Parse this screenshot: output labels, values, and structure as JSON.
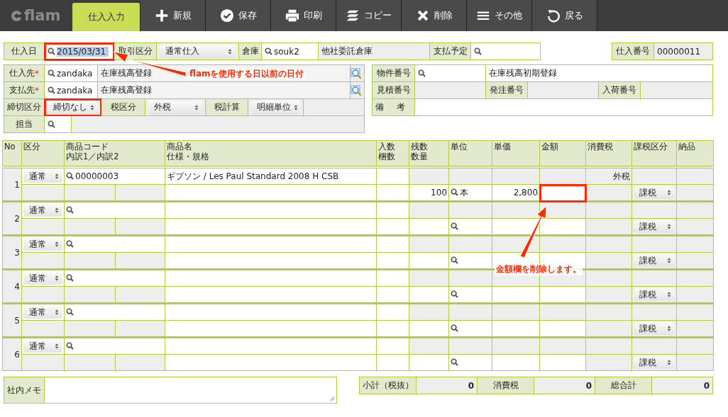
{
  "toolbar": {
    "logo": "flam",
    "items": [
      {
        "label": "仕入入力",
        "kind": "tab",
        "selected": true
      },
      {
        "label": "新規",
        "kind": "plus",
        "selected": false
      },
      {
        "label": "保存",
        "kind": "check",
        "selected": false
      },
      {
        "label": "印刷",
        "kind": "printer",
        "selected": false
      },
      {
        "label": "コピー",
        "kind": "copy",
        "selected": false
      },
      {
        "label": "削除",
        "kind": "cross",
        "selected": false
      },
      {
        "label": "その他",
        "kind": "menu",
        "selected": false
      },
      {
        "label": "戻る",
        "kind": "back",
        "selected": false
      }
    ]
  },
  "header": {
    "date_label": "仕入日",
    "date": "2015/03/31",
    "date_highlighted": true,
    "trade_label": "取引区分",
    "trade_type": "通常仕入",
    "warehouse_label": "倉庫",
    "warehouse_code": "souk2",
    "warehouse_name": "他社委託倉庫",
    "payment_label": "支払予定",
    "number_label": "仕入番号",
    "number": "00000011"
  },
  "supplier": {
    "supplier_label": "仕入先",
    "supplier_code": "zandaka",
    "supplier_name": "在庫残高登録",
    "supplier_mark": "*",
    "payee_label": "支払先",
    "payee_mark": "*",
    "payee_code": "zandaka",
    "payee_name": "在庫残高登録",
    "closing_label": "締切区分",
    "closing": "締切なし",
    "closing_highlighted": true,
    "tax_label": "税区分",
    "tax": "外税",
    "tax_calc_label": "税計算",
    "tax_calc": "明細単位",
    "staff_label": "担当"
  },
  "project": {
    "project_label": "物件番号",
    "project_name": "在庫残高初期登録",
    "estimate_label": "見積番号",
    "order_label": "発注番号",
    "arrival_label": "入荷番号",
    "note_label": "備考"
  },
  "columns": {
    "no": "No",
    "category": "区分",
    "code": "商品コード",
    "breakdown": "内訳1／内訳2",
    "name": "商品名",
    "spec": "仕様・規格",
    "pack": "入数",
    "packs": "梱数",
    "remaining": "残数",
    "quantity": "数量",
    "unit": "単位",
    "price": "単価",
    "amount": "金額",
    "tax": "消費税",
    "tax_type": "課税区分",
    "delivery": "納品"
  },
  "rows": [
    {
      "no": "1",
      "category": "通常",
      "code": "00000003",
      "name": "ギブソン / Les Paul Standard 2008 H CSB",
      "tax": "外税",
      "quantity": "100",
      "unit": "本",
      "price": "2,800",
      "tax_type": "課税",
      "amount_highlighted": true
    },
    {
      "no": "2",
      "category": "通常",
      "tax_type": "課税",
      "amount_highlighted": false
    },
    {
      "no": "3",
      "category": "通常",
      "tax_type": "課税",
      "amount_highlighted": false
    },
    {
      "no": "4",
      "category": "通常",
      "tax_type": "課税",
      "amount_highlighted": false
    },
    {
      "no": "5",
      "category": "通常",
      "tax_type": "課税",
      "amount_highlighted": false
    },
    {
      "no": "6",
      "category": "通常",
      "tax_type": "課税",
      "amount_highlighted": false
    }
  ],
  "memo_label": "社内メモ",
  "totals": [
    {
      "label": "小計（税抜）",
      "value": "0"
    },
    {
      "label": "消費税",
      "value": "0"
    },
    {
      "label": "総合計",
      "value": "0"
    }
  ],
  "annotations": [
    {
      "text": "flamを使用する日以前の日付"
    },
    {
      "text": "金額欄を削除します。"
    }
  ]
}
